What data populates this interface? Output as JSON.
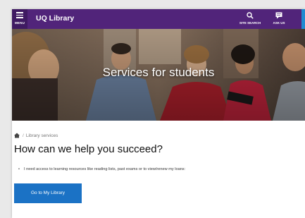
{
  "header": {
    "menu_label": "MENU",
    "brand": "UQ Library",
    "nav": [
      {
        "label": "SITE SEARCH",
        "icon": "search-icon"
      },
      {
        "label": "ASK US",
        "icon": "chat-icon"
      }
    ],
    "colors": {
      "bar": "#51247a",
      "menu": "#3f1a62",
      "accent_edge": "#1f8bd1"
    }
  },
  "hero": {
    "title": "Services for students"
  },
  "breadcrumb": {
    "home_icon": "home-icon",
    "separator": "/",
    "current": "Library services"
  },
  "main": {
    "headline": "How can we help you succeed?",
    "bullets": [
      "I need access to learning resources like reading lists, past exams or to view/renew my loans:"
    ],
    "cta_label": "Go to My Library",
    "cta_color": "#1b72c5"
  }
}
